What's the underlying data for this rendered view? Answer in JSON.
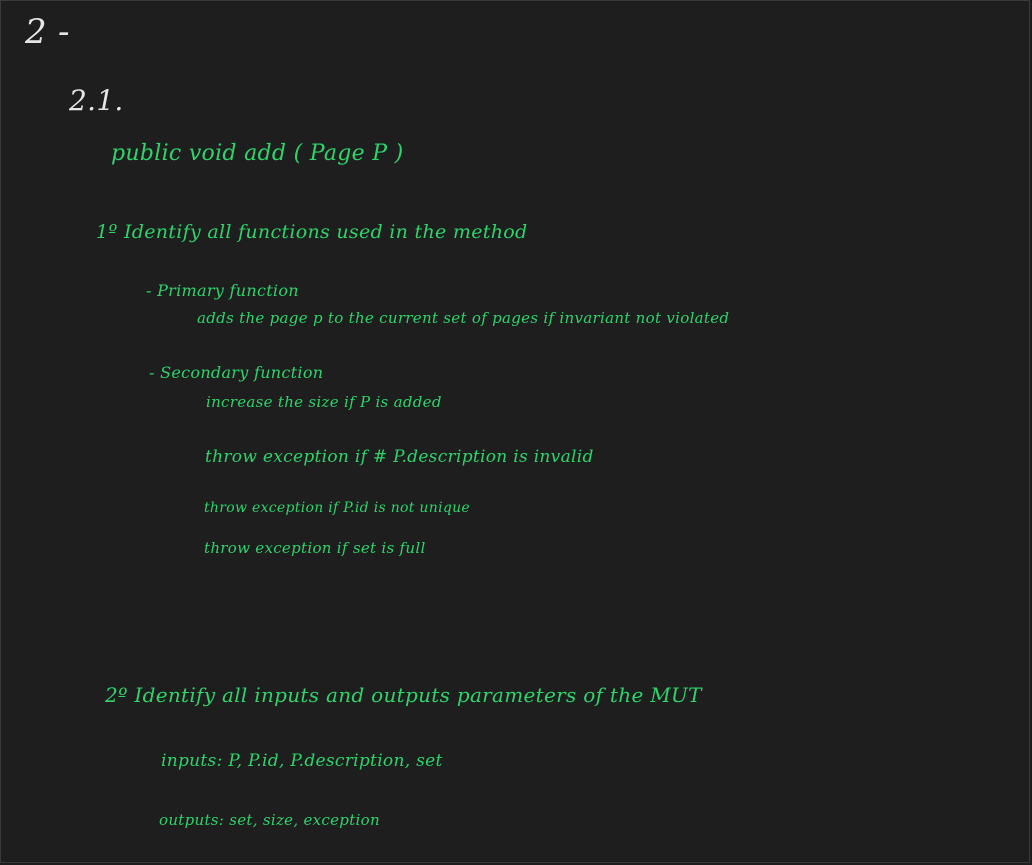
{
  "section_number": "2 -",
  "subsection_number": "2.1.",
  "method_signature": "public void add ( Page P )",
  "step1": {
    "heading": "1º Identify all functions used in the method",
    "primary": {
      "title": "- Primary function",
      "description": "adds the page p to the current set of pages if invariant not violated"
    },
    "secondary": {
      "title": "- Secondary function",
      "items": [
        "increase the size if P is added",
        "throw exception if # P.description is invalid",
        "throw exception if P.id is not unique",
        "throw exception if set is full"
      ]
    }
  },
  "step2": {
    "heading": "2º Identify all inputs and outputs parameters of the MUT",
    "inputs": "inputs: P, P.id, P.description, set",
    "outputs": "outputs: set, size, exception"
  },
  "colors": {
    "background": "#1e1e1e",
    "white_ink": "#e6e6e6",
    "green_ink": "#2fd36a"
  }
}
